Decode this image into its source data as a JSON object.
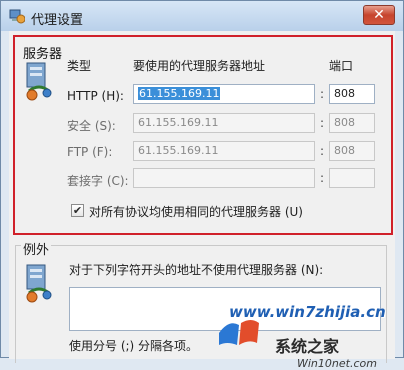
{
  "window": {
    "title": "代理设置",
    "close_glyph": "✕"
  },
  "servers": {
    "group_title": "服务器",
    "col_type": "类型",
    "col_address": "要使用的代理服务器地址",
    "col_port": "端口",
    "rows": [
      {
        "label": "HTTP (H):",
        "address": "61.155.169.11",
        "port": "808",
        "enabled": true
      },
      {
        "label": "安全 (S):",
        "address": "61.155.169.11",
        "port": "808",
        "enabled": false
      },
      {
        "label": "FTP (F):",
        "address": "61.155.169.11",
        "port": "808",
        "enabled": false
      },
      {
        "label": "套接字 (C):",
        "address": "",
        "port": "",
        "enabled": false
      }
    ],
    "colon": ":",
    "same_proxy_label": "对所有协议均使用相同的代理服务器 (U)",
    "same_proxy_checked": true
  },
  "exceptions": {
    "group_title": "例外",
    "description": "对于下列字符开头的地址不使用代理服务器 (N):",
    "value": "",
    "hint": "使用分号 (;) 分隔各项。"
  },
  "watermark": {
    "site": "www.win7zhijia.cn",
    "brand": "系统之家",
    "sub": "Win10net.com"
  },
  "colors": {
    "highlight_border": "#d0202a",
    "selection": "#3b8fd9"
  }
}
